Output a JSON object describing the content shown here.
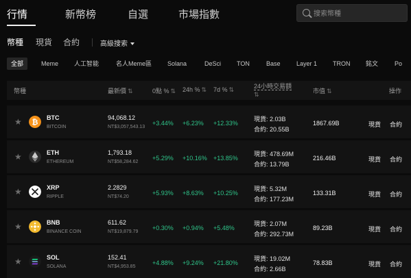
{
  "topnav": {
    "tabs": [
      "行情",
      "新幣榜",
      "自選",
      "市場指數"
    ]
  },
  "search": {
    "placeholder": "搜索幣種"
  },
  "subnav": {
    "tabs": [
      "幣種",
      "現貨",
      "合約"
    ],
    "advanced": "高級搜索"
  },
  "chips": [
    "全部",
    "Meme",
    "人工智能",
    "名人Meme區",
    "Solana",
    "DeSci",
    "TON",
    "Base",
    "Layer 1",
    "TRON",
    "銘文",
    "Po"
  ],
  "table": {
    "headers": {
      "coin": "幣種",
      "price": "最新價",
      "chg_0": "0點 %",
      "chg_24h": "24h %",
      "chg_7d": "7d %",
      "volume": "24小時交易額",
      "mcap": "市值",
      "action": "操作"
    },
    "spot_prefix": "現貨:",
    "futures_prefix": "合約:",
    "spot_btn": "現貨",
    "futures_btn": "合約",
    "rows": [
      {
        "symbol": "BTC",
        "name": "BITCOIN",
        "price": "94,068.12",
        "ntd": "NT$3,057,543.13",
        "chg_0": "+3.44%",
        "chg_24h": "+6.23%",
        "chg_7d": "+12.33%",
        "spot_vol": "2.03B",
        "fut_vol": "20.55B",
        "mcap": "1867.69B",
        "icon": "bitcoin-icon",
        "color": "#f7931a"
      },
      {
        "symbol": "ETH",
        "name": "ETHEREUM",
        "price": "1,793.18",
        "ntd": "NT$58,284.62",
        "chg_0": "+5.29%",
        "chg_24h": "+10.16%",
        "chg_7d": "+13.85%",
        "spot_vol": "478.69M",
        "fut_vol": "13.79B",
        "mcap": "216.46B",
        "icon": "ethereum-icon",
        "color": "#2b2b2b"
      },
      {
        "symbol": "XRP",
        "name": "RIPPLE",
        "price": "2.2829",
        "ntd": "NT$74.20",
        "chg_0": "+5.93%",
        "chg_24h": "+8.63%",
        "chg_7d": "+10.25%",
        "spot_vol": "5.32M",
        "fut_vol": "177.23M",
        "mcap": "133.31B",
        "icon": "xrp-icon",
        "color": "#ffffff"
      },
      {
        "symbol": "BNB",
        "name": "BINANCE COIN",
        "price": "611.62",
        "ntd": "NT$19,879.79",
        "chg_0": "+0.30%",
        "chg_24h": "+0.94%",
        "chg_7d": "+5.48%",
        "spot_vol": "2.07M",
        "fut_vol": "292.73M",
        "mcap": "89.23B",
        "icon": "bnb-icon",
        "color": "#f3ba2f"
      },
      {
        "symbol": "SOL",
        "name": "SOLANA",
        "price": "152.41",
        "ntd": "NT$4,953.85",
        "chg_0": "+4.88%",
        "chg_24h": "+9.24%",
        "chg_7d": "+21.80%",
        "spot_vol": "19.02M",
        "fut_vol": "2.66B",
        "mcap": "78.83B",
        "icon": "solana-icon",
        "color": "#1a1a1a"
      }
    ]
  },
  "colors": {
    "positive": "#2fc58a",
    "background": "#0b0b0b",
    "row_bg": "#131313"
  }
}
